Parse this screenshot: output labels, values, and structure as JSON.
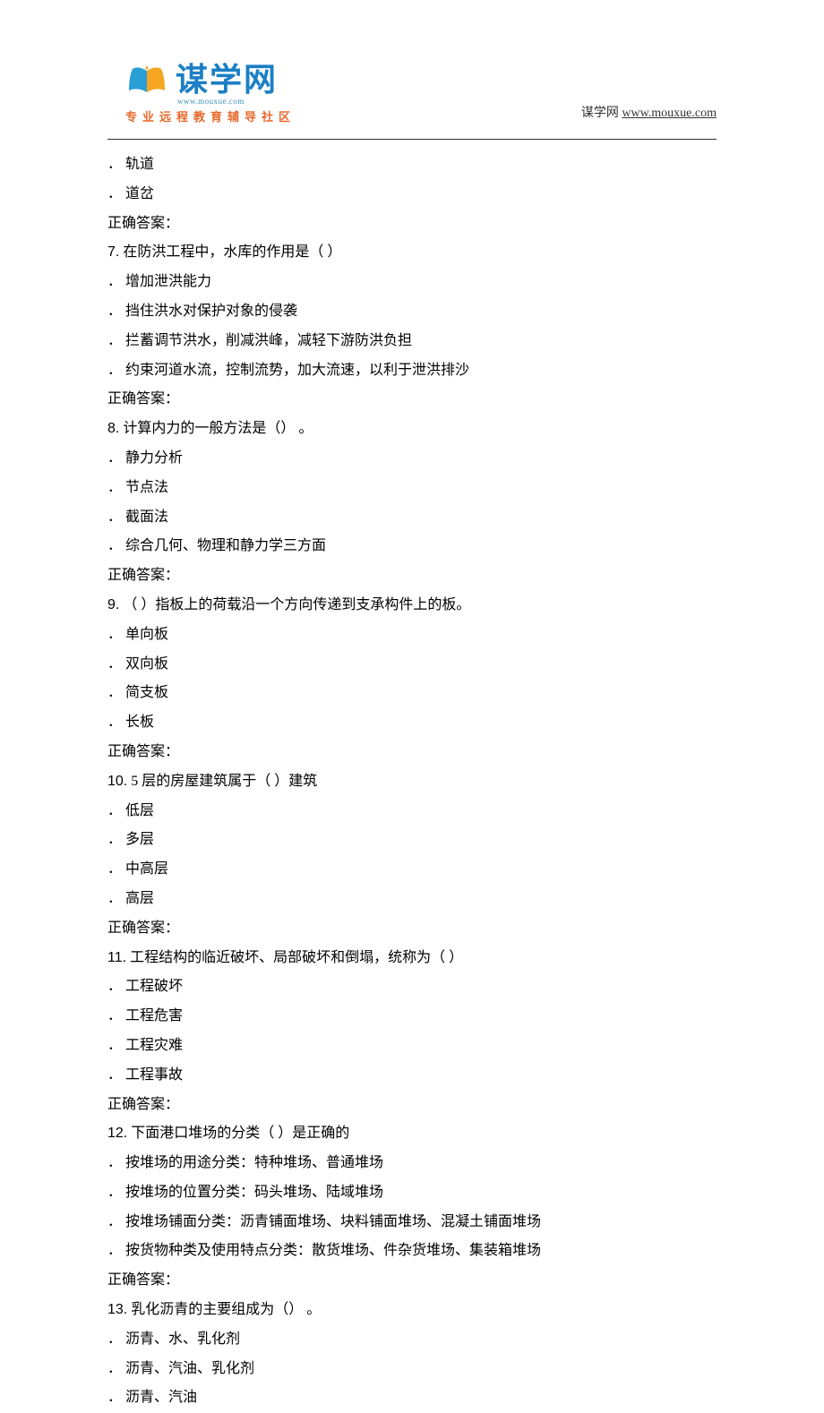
{
  "header": {
    "logo_text": "谋学网",
    "logo_url_text": "www.mouxue.com",
    "logo_subtitle": "专业远程教育辅导社区",
    "site_label": "谋学网 ",
    "site_url": "www.mouxue.com"
  },
  "content": {
    "pre_options": [
      "．  轨道",
      "．  道岔"
    ],
    "pre_answer": "正确答案：",
    "questions": [
      {
        "num": "7.",
        "stem": "    在防洪工程中，水库的作用是（       ）",
        "options": [
          "．  增加泄洪能力",
          "．  挡住洪水对保护对象的侵袭",
          "．  拦蓄调节洪水，削减洪峰，减轻下游防洪负担",
          "．  约束河道水流，控制流势，加大流速，以利于泄洪排沙"
        ],
        "answer": "正确答案："
      },
      {
        "num": "8.",
        "stem": "    计算内力的一般方法是（）   。",
        "options": [
          "．  静力分析",
          "．  节点法",
          "．  截面法",
          "．  综合几何、物理和静力学三方面"
        ],
        "answer": "正确答案："
      },
      {
        "num": "9.",
        "stem": "    （  ）指板上的荷载沿一个方向传递到支承构件上的板。",
        "options": [
          "．  单向板",
          "．  双向板",
          "．  简支板",
          "．  长板"
        ],
        "answer": "正确答案："
      },
      {
        "num": "10.",
        "stem": "  5   层的房屋建筑属于（     ）建筑",
        "options": [
          "．  低层",
          "．  多层",
          "．  中高层",
          "．  高层"
        ],
        "answer": "正确答案："
      },
      {
        "num": "11.",
        "stem": "    工程结构的临近破坏、局部破坏和倒塌，统称为（           ）",
        "options": [
          "．  工程破坏",
          "．  工程危害",
          "．  工程灾难",
          "．  工程事故"
        ],
        "answer": "正确答案："
      },
      {
        "num": "12.",
        "stem": "    下面港口堆场的分类（     ）是正确的",
        "options": [
          "．  按堆场的用途分类：特种堆场、普通堆场",
          "．  按堆场的位置分类：码头堆场、陆域堆场",
          "．  按堆场铺面分类：沥青铺面堆场、块料铺面堆场、混凝土铺面堆场",
          "．  按货物种类及使用特点分类：散货堆场、件杂货堆场、集装箱堆场"
        ],
        "answer": "正确答案："
      },
      {
        "num": "13.",
        "stem": "    乳化沥青的主要组成为（）   。",
        "options": [
          "．  沥青、水、乳化剂",
          "．  沥青、汽油、乳化剂",
          "．  沥青、汽油"
        ],
        "answer": null
      }
    ]
  }
}
